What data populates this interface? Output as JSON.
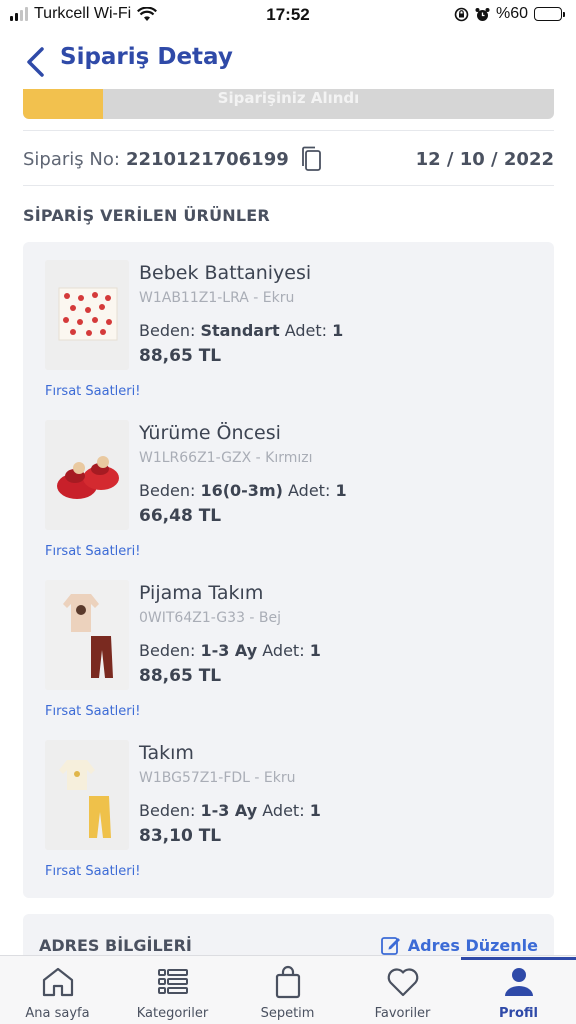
{
  "status_bar": {
    "carrier": "Turkcell Wi-Fi",
    "time": "17:52",
    "battery": "%60"
  },
  "header": {
    "title": "Sipariş Detay"
  },
  "progress": {
    "label": "Siparişiniz Alındı",
    "fraction": 0.15
  },
  "order": {
    "no_label": "Sipariş No:",
    "no_value": "2210121706199",
    "date": "12 / 10 / 2022"
  },
  "products_section": {
    "title": "SİPARİŞ VERİLEN ÜRÜNLER",
    "size_label": "Beden:",
    "qty_label": "Adet:",
    "items": [
      {
        "name": "Bebek Battaniyesi",
        "code": "W1AB11Z1-LRA - Ekru",
        "size": "Standart",
        "qty": "1",
        "price": "88,65 TL",
        "deal": "Fırsat Saatleri!",
        "thumb_icon": "strawberry-blanket-image"
      },
      {
        "name": "Yürüme Öncesi",
        "code": "W1LR66Z1-GZX - Kırmızı",
        "size": "16(0-3m)",
        "qty": "1",
        "price": "66,48 TL",
        "deal": "Fırsat Saatleri!",
        "thumb_icon": "red-baby-shoes-image"
      },
      {
        "name": "Pijama Takım",
        "code": "0WIT64Z1-G33 - Bej",
        "size": "1-3 Ay",
        "qty": "1",
        "price": "88,65 TL",
        "deal": "Fırsat Saatleri!",
        "thumb_icon": "pajama-set-image"
      },
      {
        "name": "Takım",
        "code": "W1BG57Z1-FDL - Ekru",
        "size": "1-3 Ay",
        "qty": "1",
        "price": "83,10 TL",
        "deal": "Fırsat Saatleri!",
        "thumb_icon": "outfit-set-image"
      }
    ]
  },
  "address": {
    "title": "ADRES BİLGİLERİ",
    "edit_label": "Adres Düzenle"
  },
  "tabs": [
    {
      "label": "Ana sayfa",
      "icon": "home-icon"
    },
    {
      "label": "Kategoriler",
      "icon": "list-icon"
    },
    {
      "label": "Sepetim",
      "icon": "bag-icon"
    },
    {
      "label": "Favoriler",
      "icon": "heart-icon"
    },
    {
      "label": "Profil",
      "icon": "person-icon",
      "active": true
    }
  ],
  "colors": {
    "brand": "#2f4aa8",
    "link": "#3c6bd6",
    "progress_fill": "#f2c14e",
    "progress_track": "#d6d6d6"
  }
}
